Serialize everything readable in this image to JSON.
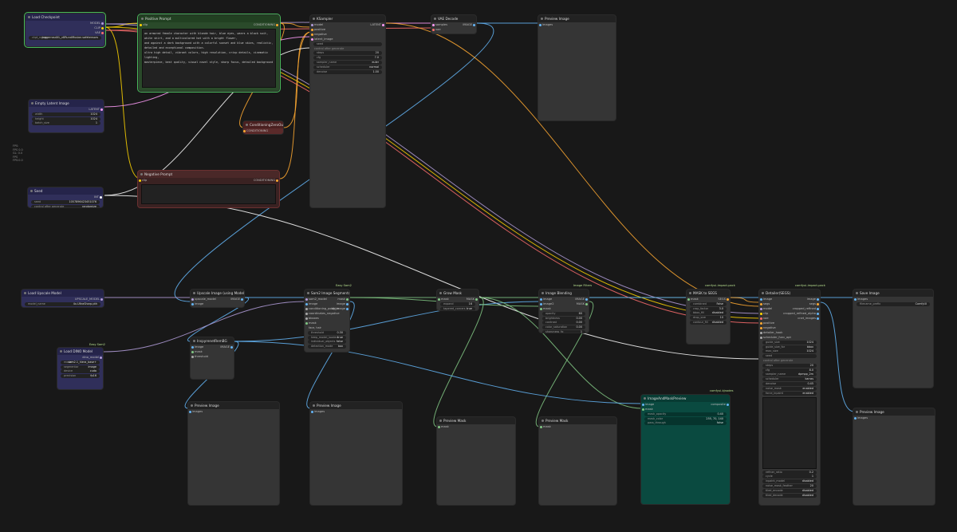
{
  "side_notes": [
    "FPS:",
    "FPS 0.0",
    "GL: 0.0",
    "FPS",
    "FPS:0.0"
  ],
  "nodes": {
    "load_checkpoint": {
      "title": "Load Checkpoint",
      "outputs": [
        "MODEL",
        "CLIP",
        "VAE"
      ],
      "widgets": [
        {
          "label": "ckpt_name",
          "value": "juggernautXL_v8Rundiffusion.safetensors"
        }
      ]
    },
    "positive_prompt": {
      "title": "Positive Prompt",
      "input": "clip",
      "output": "CONDITIONING",
      "text": [
        "an armored female character with blonde hair, blue eyes, wears a black suit, white shirt, and a multicolored hat with a bright flower,",
        "and against a dark background with a colorful sunset and blue skies, realistic, detailed and exceptional composition.",
        "ultra high detail, vibrant colors, high resolution, crisp details, cinematic lighting,",
        "masterpiece, best quality, visual novel style, sharp focus, detailed background"
      ]
    },
    "ksampler": {
      "title": "KSampler",
      "inputs": [
        "model",
        "positive",
        "negative",
        "latent_image"
      ],
      "output": "LATENT",
      "hint": "control after generate",
      "widgets": [
        {
          "label": "steps",
          "value": "20"
        },
        {
          "label": "cfg",
          "value": "7.0"
        },
        {
          "label": "sampler_name",
          "value": "euler"
        },
        {
          "label": "scheduler",
          "value": "normal"
        },
        {
          "label": "denoise",
          "value": "1.00"
        }
      ]
    },
    "vae_decode": {
      "title": "VAE Decode",
      "inputs": [
        "samples",
        "vae"
      ],
      "output": "IMAGE"
    },
    "preview_top": {
      "title": "Preview Image",
      "input": "images"
    },
    "empty_latent": {
      "title": "Empty Latent Image",
      "output": "LATENT",
      "widgets": [
        {
          "label": "width",
          "value": "1024"
        },
        {
          "label": "height",
          "value": "1024"
        },
        {
          "label": "batch_size",
          "value": "1"
        }
      ]
    },
    "cond_zero": {
      "title": "ConditioningZeroOut",
      "input": "conditioning",
      "output": "CONDITIONING"
    },
    "negative_prompt": {
      "title": "Negative Prompt",
      "input": "clip",
      "output": "CONDITIONING"
    },
    "seed": {
      "title": "Seed",
      "output": "INT",
      "widgets": [
        {
          "label": "seed",
          "value": "1057896423451076"
        },
        {
          "label": "control after generate",
          "value": "randomize"
        }
      ]
    },
    "load_upscale": {
      "title": "Load Upscale Model",
      "output": "UPSCALE_MODEL",
      "widgets": [
        {
          "label": "model_name",
          "value": "4x-UltraSharp.pth"
        }
      ]
    },
    "upscale_image": {
      "title": "Upscale Image (using Model)",
      "inputs": [
        "upscale_model",
        "image"
      ],
      "output": "IMAGE"
    },
    "sam2": {
      "title": "Sam2 Image Segmenta...",
      "badge": "Easy Sam2",
      "inputs": [
        "sam2_model",
        "image",
        "conditioning_positive",
        "coordinates_negative",
        "bboxes",
        "mask"
      ],
      "outputs": [
        "mask",
        "image",
        "bg_image"
      ],
      "ptxt": "face, hair",
      "widgets": [
        {
          "label": "threshold",
          "value": "0.30"
        },
        {
          "label": "keep_model_loaded",
          "value": "true"
        },
        {
          "label": "individual_objects",
          "value": "false"
        },
        {
          "label": "detection_mode",
          "value": "box"
        }
      ]
    },
    "grow_mask": {
      "title": "Grow Mask",
      "inputs": [
        "mask"
      ],
      "output": "MASK",
      "widgets": [
        {
          "label": "expand",
          "value": "16"
        },
        {
          "label": "tapered_corners",
          "value": "true"
        }
      ]
    },
    "image_blending": {
      "title": "Image Blending",
      "badge": "Image Filters",
      "inputs": [
        "image",
        "image2",
        "mask"
      ],
      "outputs": [
        "IMAGE",
        "MASK"
      ],
      "widgets": [
        {
          "label": "opacity",
          "value": "60"
        },
        {
          "label": "brightness",
          "value": "0.00"
        },
        {
          "label": "contrast",
          "value": "0.00"
        },
        {
          "label": "color_saturation",
          "value": "0.00"
        },
        {
          "label": "sharpness_fg",
          "value": "1"
        }
      ]
    },
    "mask_to_segs": {
      "title": "MASK to SEGS",
      "badge": "comfyui-impact-pack",
      "inputs": [
        "mask"
      ],
      "output": "SEGS",
      "widgets": [
        {
          "label": "combined",
          "value": "False"
        },
        {
          "label": "crop_factor",
          "value": "3.0"
        },
        {
          "label": "bbox_fill",
          "value": "disabled"
        },
        {
          "label": "drop_size",
          "value": "10"
        },
        {
          "label": "contour_fill",
          "value": "disabled"
        }
      ]
    },
    "detailer": {
      "title": "Detailer(SEGS)",
      "badge": "comfyui-impact-pack",
      "inputs": [
        "image",
        "segs",
        "model",
        "clip",
        "vae",
        "positive",
        "negative",
        "detailer_hook",
        "scheduler_func_opt"
      ],
      "outputs": [
        "image",
        "segs",
        "cropped_refined",
        "cropped_refined_alpha",
        "cnet_images"
      ],
      "widgets": [
        {
          "label": "guide_size",
          "value": "1024"
        },
        {
          "label": "guide_size_for",
          "value": "bbox"
        },
        {
          "label": "max_size",
          "value": "1024"
        }
      ],
      "hint": "control after generate",
      "widgets2": [
        {
          "label": "steps",
          "value": "20"
        },
        {
          "label": "cfg",
          "value": "8.0"
        },
        {
          "label": "sampler_name",
          "value": "dpmpp_2m"
        },
        {
          "label": "scheduler",
          "value": "karras"
        },
        {
          "label": "denoise",
          "value": "0.45"
        },
        {
          "label": "noise_mask",
          "value": "enabled"
        },
        {
          "label": "force_inpaint",
          "value": "enabled"
        }
      ],
      "widgets3": [
        {
          "label": "wildcard",
          "value": ""
        },
        {
          "label": "refiner_ratio",
          "value": "0.2"
        },
        {
          "label": "cycle",
          "value": "1"
        },
        {
          "label": "inpaint_model",
          "value": "disabled"
        },
        {
          "label": "noise_mask_feather",
          "value": "20"
        },
        {
          "label": "tiled_encode",
          "value": "disabled"
        },
        {
          "label": "tiled_decode",
          "value": "disabled"
        }
      ]
    },
    "save_image": {
      "title": "Save Image",
      "input": "images",
      "widgets": [
        {
          "label": "filename_prefix",
          "value": "ComfyUI"
        }
      ]
    },
    "load_dino": {
      "title": "Load DINO Model",
      "badge": "Easy Sam2",
      "output": "dino_model",
      "widgets": [
        {
          "label": "model",
          "value": "sam2.1_hiera_base+"
        },
        {
          "label": "segmentor",
          "value": "image"
        },
        {
          "label": "device",
          "value": "cuda"
        },
        {
          "label": "precision",
          "value": "fp16"
        }
      ]
    },
    "inspyrenet": {
      "title": "InspyrenetRemBG",
      "inputs": [
        "image",
        "mask",
        "threshold"
      ],
      "output": "IMAGE"
    },
    "preview_1": {
      "title": "Preview Image",
      "input": "images"
    },
    "preview_2": {
      "title": "Preview Image",
      "input": "images"
    },
    "preview_mask_1": {
      "title": "Preview Mask",
      "input": "mask"
    },
    "preview_mask_2": {
      "title": "Preview Mask",
      "input": "mask"
    },
    "overlay_preview": {
      "title": "ImageAndMaskPreview",
      "badge": "comfyui-kjnodes",
      "inputs": [
        "image",
        "mask"
      ],
      "output": "composite",
      "widgets": [
        {
          "label": "mask_opacity",
          "value": "0.40"
        },
        {
          "label": "mask_color",
          "value": "255, 70, 140"
        },
        {
          "label": "pass_through",
          "value": "false"
        }
      ]
    },
    "preview_right": {
      "title": "Preview Image",
      "input": "images"
    }
  },
  "colors": {
    "background": "#181818",
    "node": "#353535",
    "model_wire": "#b39ddb",
    "clip_wire": "#ffd500",
    "vae_wire": "#ff6e6e",
    "latent_wire": "#ff9cf9",
    "image_wire": "#64b5f6",
    "mask_wire": "#81c784",
    "cond_wire": "#ffa931",
    "int_wire": "#ffffff"
  },
  "icons": {
    "node_collapse": "dot-icon",
    "widget_arrow": "triangle-arrow-icon"
  }
}
